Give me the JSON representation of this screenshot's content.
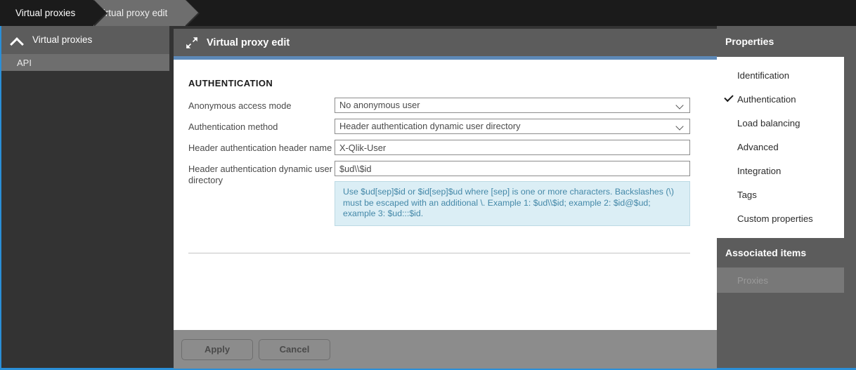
{
  "breadcrumb": {
    "items": [
      {
        "label": "Virtual proxies"
      },
      {
        "label": "Virtual proxy edit"
      }
    ]
  },
  "sidebar": {
    "header": {
      "label": "Virtual proxies",
      "icon": "chevron-up-icon"
    },
    "items": [
      {
        "label": "API"
      }
    ]
  },
  "main": {
    "header": {
      "title": "Virtual proxy edit",
      "icon": "collapse-arrows-icon"
    },
    "section_title": "AUTHENTICATION",
    "fields": [
      {
        "label": "Anonymous access mode",
        "type": "select",
        "value": "No anonymous user"
      },
      {
        "label": "Authentication method",
        "type": "select",
        "value": "Header authentication dynamic user directory"
      },
      {
        "label": "Header authentication header name",
        "type": "text",
        "value": "X-Qlik-User"
      },
      {
        "label": "Header authentication dynamic user directory",
        "type": "text",
        "value": "$ud\\\\$id"
      }
    ],
    "hint": "Use $ud[sep]$id or $id[sep]$ud where [sep] is one or more characters. Backslashes (\\) must be escaped with an additional \\. Example 1: $ud\\\\$id; example 2: $id@$ud; example 3: $ud:::$id.",
    "footer": {
      "apply_label": "Apply",
      "cancel_label": "Cancel"
    }
  },
  "properties": {
    "title": "Properties",
    "items": [
      {
        "label": "Identification",
        "selected": false
      },
      {
        "label": "Authentication",
        "selected": true
      },
      {
        "label": "Load balancing",
        "selected": false
      },
      {
        "label": "Advanced",
        "selected": false
      },
      {
        "label": "Integration",
        "selected": false
      },
      {
        "label": "Tags",
        "selected": false
      },
      {
        "label": "Custom properties",
        "selected": false
      }
    ]
  },
  "associated_items": {
    "title": "Associated items",
    "items": [
      {
        "label": "Proxies"
      }
    ]
  },
  "colors": {
    "accent_blue": "#2a8fd8",
    "header_accent": "#5d89b8",
    "panel_grey": "#5c5c5c",
    "hint_bg": "#dbeef5",
    "hint_text": "#4488a8"
  }
}
